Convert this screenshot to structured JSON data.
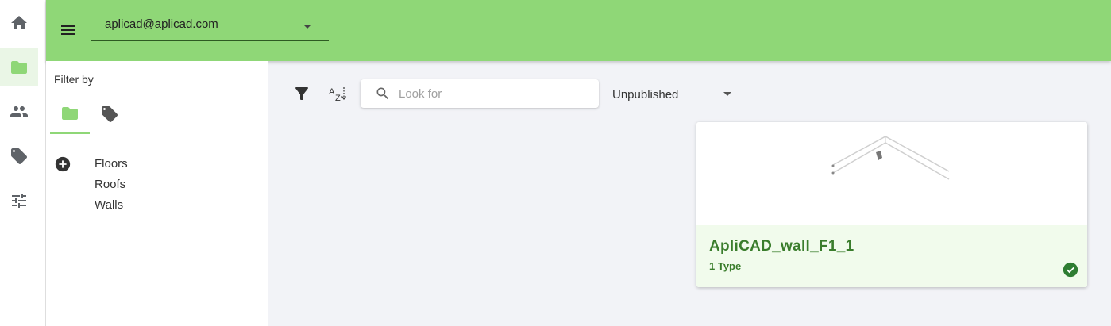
{
  "nav_rail": {
    "items": [
      {
        "name": "home",
        "icon": "home-icon"
      },
      {
        "name": "folders",
        "icon": "folder-icon",
        "active": true
      },
      {
        "name": "users",
        "icon": "people-icon"
      },
      {
        "name": "tags",
        "icon": "tag-icon"
      },
      {
        "name": "settings",
        "icon": "sliders-icon"
      }
    ]
  },
  "header": {
    "menu_icon": "hamburger-menu-icon",
    "account_value": "aplicad@aplicad.com"
  },
  "filter_panel": {
    "title": "Filter by",
    "tabs": [
      {
        "icon": "folder-icon",
        "active": true
      },
      {
        "icon": "tag-icon",
        "active": false
      }
    ],
    "add_icon": "add-circle-icon",
    "items": [
      {
        "label": "Floors"
      },
      {
        "label": "Roofs"
      },
      {
        "label": "Walls"
      }
    ]
  },
  "toolbar": {
    "filter_icon": "filter-icon",
    "sort_icon": "sort-az-icon",
    "search_placeholder": "Look for",
    "search_value": "",
    "status_value": "Unpublished"
  },
  "cards": [
    {
      "title": "ApliCAD_wall_F1_1",
      "subtitle": "1 Type",
      "status_icon": "check-circle-icon"
    }
  ],
  "colors": {
    "accent": "#8fd777",
    "accent_dark": "#3a7d2c",
    "rail_active_bg": "#eaf6e6",
    "card_footer_bg": "#f1fbec",
    "page_bg": "#f2f3f7"
  }
}
